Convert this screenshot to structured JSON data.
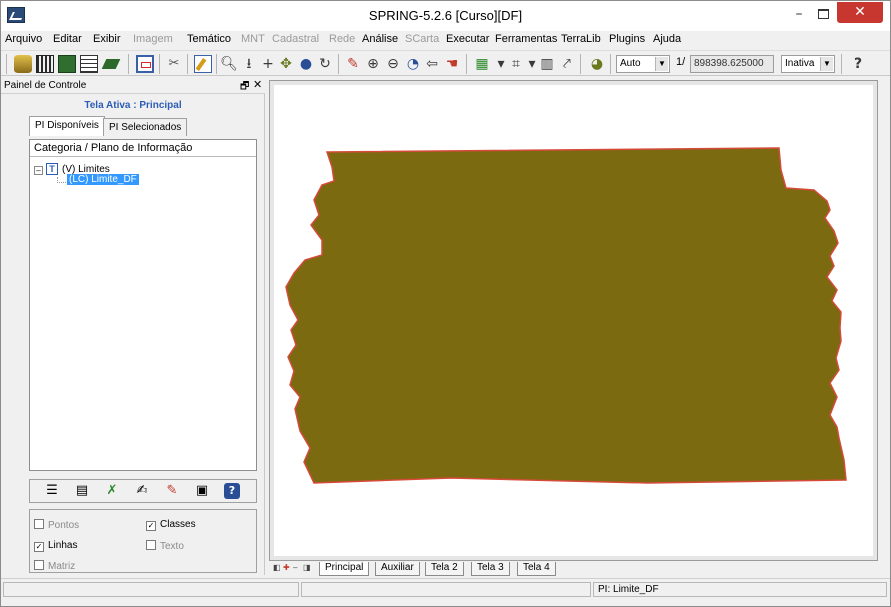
{
  "window": {
    "title": "SPRING-5.2.6 [Curso][DF]",
    "minimize": "–",
    "close": "✕"
  },
  "menu": [
    {
      "label": "Arquivo",
      "enabled": true
    },
    {
      "label": "Editar",
      "enabled": true
    },
    {
      "label": "Exibir",
      "enabled": true
    },
    {
      "label": "Imagem",
      "enabled": false
    },
    {
      "label": "Temático",
      "enabled": true
    },
    {
      "label": "MNT",
      "enabled": false
    },
    {
      "label": "Cadastral",
      "enabled": false
    },
    {
      "label": "Rede",
      "enabled": false
    },
    {
      "label": "Análise",
      "enabled": true
    },
    {
      "label": "SCarta",
      "enabled": false
    },
    {
      "label": "Executar",
      "enabled": true
    },
    {
      "label": "Ferramentas",
      "enabled": true
    },
    {
      "label": "TerraLib",
      "enabled": true
    },
    {
      "label": "Plugins",
      "enabled": true
    },
    {
      "label": "Ajuda",
      "enabled": true
    }
  ],
  "toolbar": {
    "mode_select": "Auto",
    "scale_prefix": "1/",
    "scale_value": "898398.625000",
    "status_select": "Inativa",
    "help_glyph": "?"
  },
  "panel": {
    "title": "Painel de Controle",
    "pin": "🗗",
    "close": "✕",
    "active_screen": "Tela Ativa : Principal",
    "tabs": [
      {
        "label": "PI Disponíveis",
        "active": true
      },
      {
        "label": "PI Selecionados",
        "active": false
      }
    ],
    "tree_header": "Categoria / Plano de Informação",
    "tree": {
      "category_expander": "–",
      "category_type": "T",
      "category_label": "(V) Limites",
      "plan_label": "(LC) Limite_DF"
    },
    "show": {
      "pontos": {
        "label": "Pontos",
        "checked": false,
        "mark": ""
      },
      "linhas": {
        "label": "Linhas",
        "checked": true,
        "mark": "✓"
      },
      "matriz": {
        "label": "Matriz",
        "checked": false,
        "mark": ""
      },
      "classes": {
        "label": "Classes",
        "checked": true,
        "mark": "✓"
      },
      "texto": {
        "label": "Texto",
        "checked": false,
        "mark": ""
      }
    }
  },
  "map": {
    "fill_color": "#7b6a0f",
    "border_color": "#d64a3a"
  },
  "screen_tabs": [
    "Principal",
    "Auxiliar",
    "Tela 2",
    "Tela 3",
    "Tela 4"
  ],
  "status": {
    "pi": "PI: Limite_DF"
  },
  "colors": {
    "accent_blue": "#2c5cb6",
    "selection": "#3399ff",
    "close_red": "#c7372f"
  }
}
